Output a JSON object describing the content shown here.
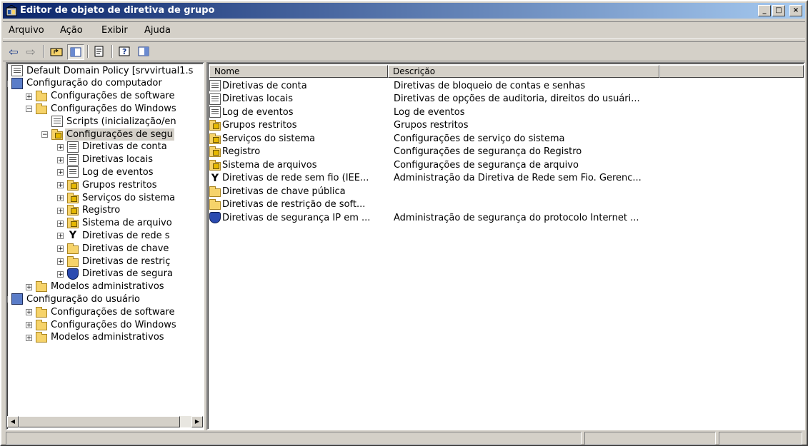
{
  "window": {
    "title": "Editor de objeto de diretiva de grupo",
    "minimize": "_",
    "maximize": "□",
    "close": "×"
  },
  "menu": [
    "Arquivo",
    "Ação",
    "Exibir",
    "Ajuda"
  ],
  "toolbar": {
    "back": "⇦",
    "forward": "⇨",
    "up": "⇧",
    "help": "?"
  },
  "tree": [
    {
      "label": "Default Domain Policy [srvvirtual1.s",
      "icon": "policy-icon"
    },
    {
      "label": "Configuração do computador",
      "icon": "computer-icon"
    },
    {
      "label": "Configurações de software",
      "icon": "folder-icon"
    },
    {
      "label": "Configurações do Windows",
      "icon": "folder-icon"
    },
    {
      "label": "Scripts (inicialização/en",
      "icon": "script-icon"
    },
    {
      "label": "Configurações de segu",
      "icon": "lock-folder-icon"
    },
    {
      "label": "Diretivas de conta",
      "icon": "policy-icon"
    },
    {
      "label": "Diretivas locais",
      "icon": "policy-icon"
    },
    {
      "label": "Log de eventos",
      "icon": "policy-icon"
    },
    {
      "label": "Grupos restritos",
      "icon": "lock-folder-icon"
    },
    {
      "label": "Serviços do sistema",
      "icon": "lock-folder-icon"
    },
    {
      "label": "Registro",
      "icon": "lock-folder-icon"
    },
    {
      "label": "Sistema de arquivo",
      "icon": "lock-folder-icon"
    },
    {
      "label": "Diretivas de rede s",
      "icon": "antenna-icon"
    },
    {
      "label": "Diretivas de chave",
      "icon": "folder-icon"
    },
    {
      "label": "Diretivas de restriç",
      "icon": "folder-icon"
    },
    {
      "label": "Diretivas de segura",
      "icon": "shield-icon"
    },
    {
      "label": "Modelos administrativos",
      "icon": "folder-icon"
    },
    {
      "label": "Configuração do usuário",
      "icon": "user-icon"
    },
    {
      "label": "Configurações de software",
      "icon": "folder-icon"
    },
    {
      "label": "Configurações do Windows",
      "icon": "folder-icon"
    },
    {
      "label": "Modelos administrativos",
      "icon": "folder-icon"
    }
  ],
  "list": {
    "columns": [
      "Nome",
      "Descrição"
    ],
    "rows": [
      {
        "name": "Diretivas de conta",
        "desc": "Diretivas de bloqueio de contas e senhas",
        "icon": "policy-icon"
      },
      {
        "name": "Diretivas locais",
        "desc": "Diretivas de opções de auditoria, direitos do usuári...",
        "icon": "policy-icon"
      },
      {
        "name": "Log de eventos",
        "desc": "Log de eventos",
        "icon": "policy-icon"
      },
      {
        "name": "Grupos restritos",
        "desc": "Grupos restritos",
        "icon": "lock-folder-icon"
      },
      {
        "name": "Serviços do sistema",
        "desc": "Configurações de serviço do sistema",
        "icon": "lock-folder-icon"
      },
      {
        "name": "Registro",
        "desc": "Configurações de segurança do Registro",
        "icon": "lock-folder-icon"
      },
      {
        "name": "Sistema de arquivos",
        "desc": "Configurações de segurança de arquivo",
        "icon": "lock-folder-icon"
      },
      {
        "name": "Diretivas de rede sem fio (IEE...",
        "desc": "Administração da Diretiva de Rede sem Fio. Gerenc...",
        "icon": "antenna-icon"
      },
      {
        "name": "Diretivas de chave pública",
        "desc": "",
        "icon": "folder-icon"
      },
      {
        "name": "Diretivas de restrição de soft...",
        "desc": "",
        "icon": "folder-icon"
      },
      {
        "name": "Diretivas de segurança IP em ...",
        "desc": "Administração de segurança do protocolo Internet ...",
        "icon": "shield-icon"
      }
    ]
  },
  "statusbar": [
    "",
    "",
    ""
  ]
}
